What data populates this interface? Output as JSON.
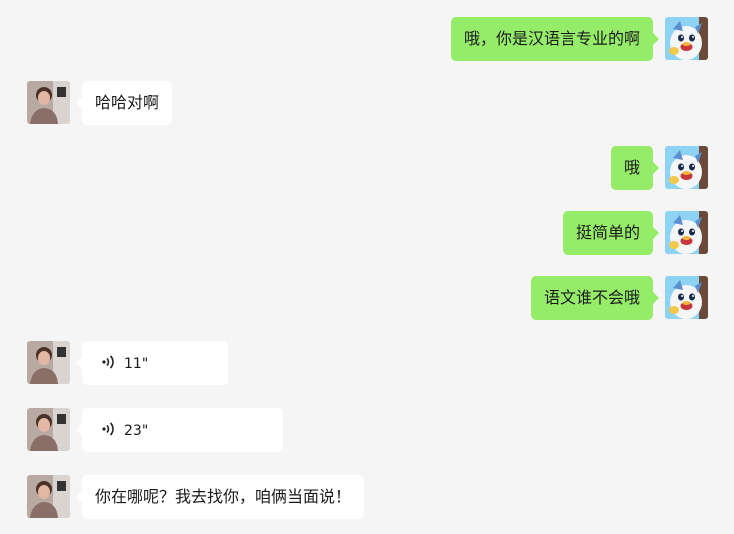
{
  "messages": [
    {
      "side": "me",
      "type": "text",
      "text": "哦，你是汉语言专业的啊"
    },
    {
      "side": "other",
      "type": "text",
      "text": "哈哈对啊"
    },
    {
      "side": "me",
      "type": "text",
      "text": "哦"
    },
    {
      "side": "me",
      "type": "text",
      "text": "挺简单的"
    },
    {
      "side": "me",
      "type": "text",
      "text": "语文谁不会哦"
    },
    {
      "side": "other",
      "type": "voice",
      "duration": "11\""
    },
    {
      "side": "other",
      "type": "voice",
      "duration": "23\""
    },
    {
      "side": "other",
      "type": "text",
      "text": "你在哪呢？我去找你，咱俩当面说！"
    }
  ],
  "icons": {
    "my_avatar": "cartoon-penguin-avatar",
    "other_avatar": "photo-person-avatar",
    "voice": "voice-wave-icon"
  },
  "colors": {
    "background": "#f5f5f5",
    "my_bubble": "#95ec69",
    "other_bubble": "#ffffff"
  }
}
